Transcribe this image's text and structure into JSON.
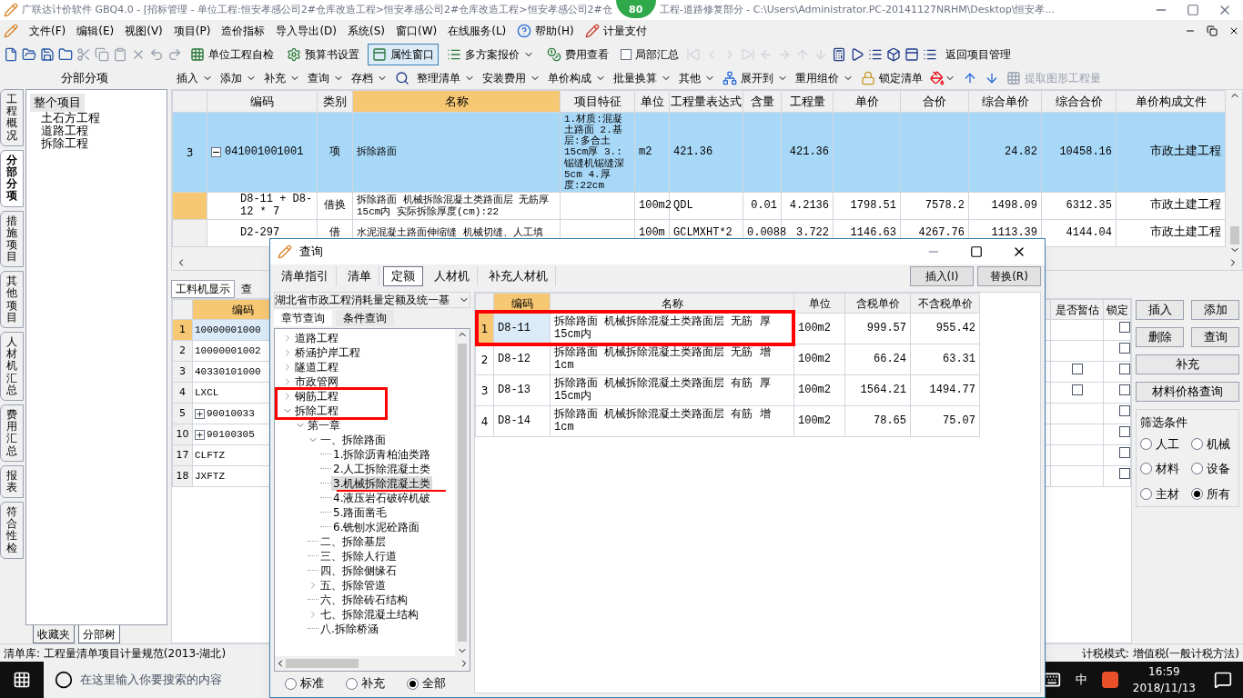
{
  "window": {
    "title": "广联达计价软件 GBQ4.0 - [招标管理 - 单位工程:恒安孝感公司2#仓库改造工程>恒安孝感公司2#仓库改造工程>恒安孝感公司2#仓",
    "title_end": "工程-道路修复部分 - C:\\Users\\Administrator.PC-20141127NRHM\\Desktop\\恒安孝...",
    "badge": "80"
  },
  "menu": [
    {
      "label": "文件(F)",
      "kind": "text"
    },
    {
      "label": "编辑(E)",
      "kind": "text"
    },
    {
      "label": "视图(V)",
      "kind": "text"
    },
    {
      "label": "项目(P)",
      "kind": "text"
    },
    {
      "label": "造价指标",
      "kind": "text"
    },
    {
      "label": "导入导出(D)",
      "kind": "text"
    },
    {
      "label": "系统(S)",
      "kind": "text"
    },
    {
      "label": "窗口(W)",
      "kind": "text"
    },
    {
      "label": "在线服务(L)",
      "kind": "text"
    },
    {
      "label": "帮助(H)",
      "kind": "help"
    },
    {
      "label": "计量支付",
      "kind": "pay"
    }
  ],
  "toolbar": [
    {
      "label": "单位工程自检",
      "kind": "check",
      "selected": false
    },
    {
      "label": "预算书设置",
      "kind": "settings",
      "selected": false
    },
    {
      "label": "属性窗口",
      "kind": "window",
      "selected": true
    },
    {
      "label": "多方案报价",
      "kind": "dropdown",
      "selected": false
    },
    {
      "label": "费用查看",
      "kind": "money",
      "selected": false
    },
    {
      "label": "局部汇总",
      "kind": "checkbox",
      "checked": false
    },
    {
      "label": "返回项目管理",
      "kind": "return",
      "selected": false
    }
  ],
  "toolbar2": [
    {
      "label": "插入",
      "kind": "dropdown",
      "disabled": false
    },
    {
      "label": "添加",
      "kind": "dropdown",
      "disabled": false
    },
    {
      "label": "补充",
      "kind": "dropdown",
      "disabled": false
    },
    {
      "label": "查询",
      "kind": "dropdown",
      "disabled": false
    },
    {
      "label": "存档",
      "kind": "dropdown",
      "disabled": false
    },
    {
      "kind": "find"
    },
    {
      "label": "整理清单",
      "kind": "dropdown",
      "disabled": false
    },
    {
      "label": "安装费用",
      "kind": "dropdown",
      "disabled": false
    },
    {
      "label": "单价构成",
      "kind": "dropdown",
      "disabled": false
    },
    {
      "label": "批量换算",
      "kind": "dropdown",
      "disabled": false
    },
    {
      "label": "其他",
      "kind": "dropdown",
      "disabled": false
    },
    {
      "label": "展开到",
      "kind": "expand",
      "disabled": false
    },
    {
      "label": "重用组价",
      "kind": "dropdown",
      "disabled": false
    },
    {
      "label": "锁定清单",
      "kind": "lock",
      "disabled": false
    },
    {
      "kind": "fill"
    },
    {
      "kind": "up"
    },
    {
      "kind": "down"
    },
    {
      "label": "提取图形工程量",
      "kind": "extract",
      "disabled": true
    }
  ],
  "side_tabs": [
    {
      "label": "工程概况",
      "selected": false
    },
    {
      "label": "分部分项",
      "selected": true
    },
    {
      "label": "措施项目",
      "selected": false
    },
    {
      "label": "其他项目",
      "selected": false
    },
    {
      "label": "人材机汇总",
      "selected": false
    },
    {
      "label": "费用汇总",
      "selected": false
    },
    {
      "label": "报表",
      "selected": false
    },
    {
      "label": "符合性检",
      "selected": false
    }
  ],
  "tree_panel": {
    "title": "分部分项",
    "root": "整个项目",
    "items": [
      "土石方工程",
      "道路工程",
      "拆除工程"
    ],
    "tabs": [
      {
        "label": "收藏夹",
        "selected": false
      },
      {
        "label": "分部树",
        "selected": true
      }
    ]
  },
  "table": {
    "columns": [
      "编码",
      "类别",
      "名称",
      "项目特征",
      "单位",
      "工程量表达式",
      "含量",
      "工程量",
      "单价",
      "合价",
      "综合单价",
      "综合合价",
      "单价构成文件"
    ],
    "rows": [
      {
        "no": "3",
        "expanded": true,
        "selected": true,
        "cells": [
          "041001001001",
          "项",
          "拆除路面",
          "1.材质:混凝土路面 2.基层:多合土15cm厚 3.:锯缝机锯缝深5cm 4.厚度:22cm",
          "m2",
          "421.36",
          "",
          "421.36",
          "",
          "",
          "24.82",
          "10458.16",
          "市政土建工程"
        ]
      },
      {
        "selected": false,
        "cells": [
          "D8-11 + D8-12 * 7",
          "借换",
          "拆除路面 机械拆除混凝土类路面层 无筋厚15cm内 实际拆除厚度(cm):22",
          "",
          "100m2",
          "QDL",
          "0.01",
          "4.2136",
          "1798.51",
          "7578.2",
          "1498.09",
          "6312.35",
          "市政土建工程"
        ]
      },
      {
        "selected": false,
        "cells": [
          "D2-297",
          "借",
          "水泥混凝土路面伸缩缝 机械切缝、人工填",
          "",
          "100m",
          "GCLMXHT*2",
          "0.0088",
          "3.722",
          "1146.63",
          "4267.76",
          "1113.39",
          "4144.04",
          "市政土建工程"
        ]
      }
    ]
  },
  "lower": {
    "tabs": [
      {
        "label": "工料机显示",
        "selected": true
      },
      {
        "label": "查",
        "selected": false
      }
    ],
    "columns": [
      "编码",
      "是否暂估",
      "锁定"
    ],
    "rows": [
      {
        "no": "1",
        "code": "10000001000",
        "selected": true,
        "expandable": false,
        "estimate": null,
        "locked": false
      },
      {
        "no": "2",
        "code": "10000001002",
        "selected": false,
        "expandable": false,
        "estimate": null,
        "locked": false
      },
      {
        "no": "3",
        "code": "40330101000",
        "selected": false,
        "expandable": false,
        "estimate": false,
        "locked": false
      },
      {
        "no": "4",
        "code": "LXCL",
        "selected": false,
        "expandable": false,
        "estimate": false,
        "locked": false
      },
      {
        "no": "5",
        "code": "90010033",
        "selected": false,
        "expandable": true,
        "estimate": null,
        "locked": false
      },
      {
        "no": "10",
        "code": "90100305",
        "selected": false,
        "expandable": true,
        "estimate": null,
        "locked": false
      },
      {
        "no": "17",
        "code": "CLFTZ",
        "selected": false,
        "expandable": false,
        "estimate": null,
        "locked": false
      },
      {
        "no": "18",
        "code": "JXFTZ",
        "selected": false,
        "expandable": false,
        "estimate": null,
        "locked": false
      }
    ],
    "buttons": [
      "插入",
      "添加",
      "删除",
      "查询"
    ],
    "wide_buttons": [
      "补充",
      "材料价格查询"
    ],
    "filter": {
      "title": "筛选条件",
      "options": [
        {
          "label": "人工",
          "selected": false
        },
        {
          "label": "机械",
          "selected": false
        },
        {
          "label": "材料",
          "selected": false
        },
        {
          "label": "设备",
          "selected": false
        },
        {
          "label": "主材",
          "selected": false
        },
        {
          "label": "所有",
          "selected": true
        }
      ]
    }
  },
  "dialog": {
    "title": "查询",
    "tabs": [
      {
        "label": "清单指引",
        "selected": false
      },
      {
        "label": "清单",
        "selected": false
      },
      {
        "label": "定额",
        "selected": true
      },
      {
        "label": "人材机",
        "selected": false
      },
      {
        "label": "补充人材机",
        "selected": false
      }
    ],
    "buttons": [
      "插入(I)",
      "替换(R)"
    ],
    "library": "湖北省市政工程消耗量定额及统一基",
    "query_tabs": [
      {
        "label": "章节查询",
        "selected": true
      },
      {
        "label": "条件查询",
        "selected": false
      }
    ],
    "tree": [
      {
        "label": "道路工程",
        "expanded": false,
        "selected": false
      },
      {
        "label": "桥涵护岸工程",
        "expanded": false,
        "selected": false
      },
      {
        "label": "隧道工程",
        "expanded": false,
        "selected": false
      },
      {
        "label": "市政管网",
        "expanded": false,
        "selected": false
      },
      {
        "label": "钢筋工程",
        "expanded": false,
        "selected": false
      },
      {
        "label": "拆除工程",
        "expanded": true,
        "selected": false,
        "children": [
          {
            "label": "第一章",
            "expanded": true,
            "selected": false,
            "children": [
              {
                "label": "一、拆除路面",
                "expanded": true,
                "selected": false,
                "children": [
                  {
                    "label": "1.拆除沥青柏油类路",
                    "selected": false
                  },
                  {
                    "label": "2.人工拆除混凝土类",
                    "selected": false
                  },
                  {
                    "label": "3.机械拆除混凝土类",
                    "selected": true
                  },
                  {
                    "label": "4.液压岩石破碎机破",
                    "selected": false
                  },
                  {
                    "label": "5.路面凿毛",
                    "selected": false
                  },
                  {
                    "label": "6.铣刨水泥砼路面",
                    "selected": false
                  }
                ]
              },
              {
                "label": "二、拆除基层",
                "selected": false
              },
              {
                "label": "三、拆除人行道",
                "selected": false
              },
              {
                "label": "四、拆除侧缘石",
                "selected": false
              },
              {
                "label": "五、拆除管道",
                "expanded": false,
                "selected": false
              },
              {
                "label": "六、拆除砖石结构",
                "selected": false
              },
              {
                "label": "七、拆除混凝土结构",
                "expanded": false,
                "selected": false
              },
              {
                "label": "八.拆除桥涵",
                "selected": false
              }
            ]
          }
        ]
      }
    ],
    "scope": [
      {
        "label": "标准",
        "selected": false
      },
      {
        "label": "补充",
        "selected": false
      },
      {
        "label": "全部",
        "selected": true
      }
    ],
    "columns": [
      "编码",
      "名称",
      "单位",
      "含税单价",
      "不含税单价"
    ],
    "rows": [
      {
        "no": "1",
        "selected": true,
        "cells": [
          "D8-11",
          "拆除路面 机械拆除混凝土类路面层 无筋 厚15cm内",
          "100m2",
          "999.57",
          "955.42"
        ]
      },
      {
        "no": "2",
        "selected": false,
        "cells": [
          "D8-12",
          "拆除路面 机械拆除混凝土类路面层 无筋 增1cm",
          "100m2",
          "66.24",
          "63.31"
        ]
      },
      {
        "no": "3",
        "selected": false,
        "cells": [
          "D8-13",
          "拆除路面 机械拆除混凝土类路面层 有筋 厚15cm内",
          "100m2",
          "1564.21",
          "1494.77"
        ]
      },
      {
        "no": "4",
        "selected": false,
        "cells": [
          "D8-14",
          "拆除路面 机械拆除混凝土类路面层 有筋 增1cm",
          "100m2",
          "78.65",
          "75.07"
        ]
      }
    ]
  },
  "status_bar": {
    "left": "清单库: 工程量清单项目计量规范(2013-湖北)",
    "right": "计税模式: 增值税(一般计税方法)"
  },
  "taskbar": {
    "search_placeholder": "在这里输入你要搜索的内容",
    "ime": "中",
    "time": "16:59",
    "date": "2018/11/13"
  }
}
